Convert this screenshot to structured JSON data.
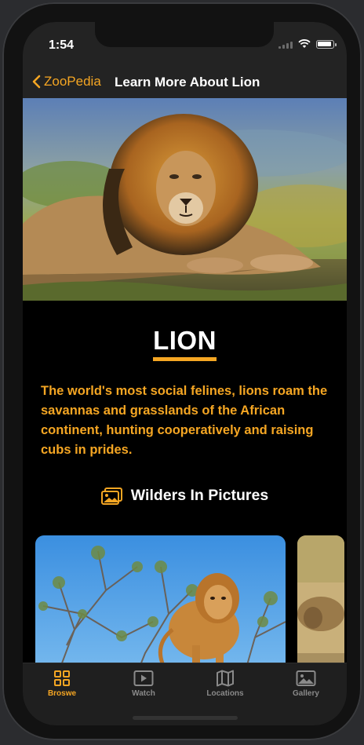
{
  "status_bar": {
    "time": "1:54"
  },
  "nav": {
    "back_label": "ZooPedia",
    "title": "Learn More About Lion"
  },
  "animal": {
    "name": "LION",
    "description": "The world's most social felines, lions roam the savannas and grasslands of the African continent, hunting cooperatively and raising cubs in prides."
  },
  "gallery": {
    "heading": "Wilders In Pictures"
  },
  "tabs": [
    {
      "label": "Broswe",
      "icon": "grid-icon",
      "active": true
    },
    {
      "label": "Watch",
      "icon": "play-icon",
      "active": false
    },
    {
      "label": "Locations",
      "icon": "map-icon",
      "active": false
    },
    {
      "label": "Gallery",
      "icon": "photo-icon",
      "active": false
    }
  ],
  "colors": {
    "accent": "#f5a623",
    "background": "#000000",
    "bar": "#232323"
  }
}
